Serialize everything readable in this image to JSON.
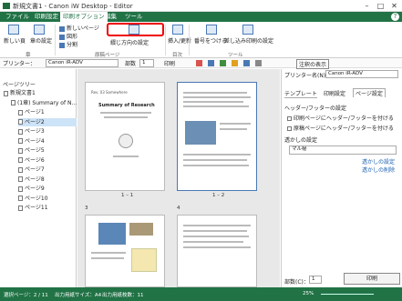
{
  "window": {
    "title": "新規文書1 - Canon iW Desktop - Editor",
    "minimize": "–",
    "maximize": "□",
    "close": "✕"
  },
  "ribbon_tabs": [
    "ファイル",
    "印刷設定",
    "印刷オプション",
    "編集",
    "ツール"
  ],
  "help": "?",
  "ribbon": {
    "new_page": "新しい頁",
    "section_setting": "章の設定",
    "blank_page": "新しいページ",
    "figure": "図形",
    "split": "分割",
    "binding_layout": "綴じ方向の設定",
    "insert_toc": "挿入/更新",
    "number_all": "番号をつける",
    "number_settings": "差し込み印刷の設定",
    "group_chapter": "章",
    "group_page": "原稿ページ",
    "group_toc": "目次",
    "group_tools": "ツール"
  },
  "toolbar": {
    "printer_label": "プリンター：",
    "printer_value": "Canon iR-ADV",
    "copies_label": "部数",
    "copies_value": "1",
    "print_btn": "印刷",
    "notes_btn": "注釈の表示"
  },
  "left_panel": {
    "header": "ページツリー",
    "items": [
      {
        "label": "新規文書1",
        "indent": 0
      },
      {
        "label": "(1章) Summary of N...",
        "indent": 1
      },
      {
        "label": "ページ1",
        "indent": 2
      },
      {
        "label": "ページ2",
        "indent": 2,
        "selected": true
      },
      {
        "label": "ページ3",
        "indent": 2
      },
      {
        "label": "ページ4",
        "indent": 2
      },
      {
        "label": "ページ5",
        "indent": 2
      },
      {
        "label": "ページ6",
        "indent": 2
      },
      {
        "label": "ページ7",
        "indent": 2
      },
      {
        "label": "ページ8",
        "indent": 2
      },
      {
        "label": "ページ9",
        "indent": 2
      },
      {
        "label": "ページ10",
        "indent": 2
      },
      {
        "label": "ページ11",
        "indent": 2
      }
    ]
  },
  "pages": {
    "p1_label": "1 – 1",
    "p2_label": "1 – 2",
    "p3_label": "3",
    "p4_label": "4",
    "p1_heading": "Summary of Research",
    "p1_top": "Rev. 03 Somewhere"
  },
  "right_panel": {
    "printer_label": "プリンター名(N)：",
    "printer_value": "Canon iR-ADV",
    "tabs": [
      "テンプレート",
      "印刷設定",
      "ページ設定"
    ],
    "section_header_footer": "ヘッダー/フッターの設定",
    "opt1": "印刷ページにヘッダー/フッターを付ける",
    "opt2": "原稿ページにヘッダー/フッターを付ける",
    "section_watermark": "透かしの設定",
    "watermark_value": "マル秘",
    "link1": "透かしの設定",
    "link2": "透かしの削除",
    "copies_label": "部数(C)：",
    "copies_value": "1",
    "print_button": "印刷"
  },
  "status": {
    "selected": "選択ページ：2 / 11",
    "paper": "出力用紙サイズ：A4",
    "count": "出力用紙枚数：11",
    "zoom": "25%"
  }
}
